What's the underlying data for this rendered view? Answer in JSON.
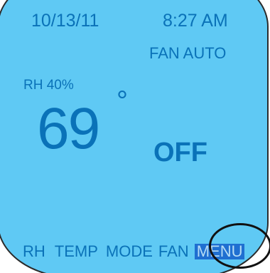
{
  "status_bar": {
    "date": "10/13/11",
    "time": "8:27 AM"
  },
  "fan": {
    "status": "FAN AUTO"
  },
  "humidity": {
    "label": "RH  40%"
  },
  "temperature": {
    "value": "69",
    "degree_symbol": "°"
  },
  "mode": {
    "state": "OFF"
  },
  "softkeys": [
    {
      "label": "RH"
    },
    {
      "label": "TEMP"
    },
    {
      "label": "MODE"
    },
    {
      "label": "FAN"
    },
    {
      "label": "MENU",
      "selected": true
    }
  ],
  "colors": {
    "screen_background": "#5fc9f4",
    "text": "#0a72b8",
    "selected_background": "#1f6fd1",
    "annotation": "#111111"
  }
}
